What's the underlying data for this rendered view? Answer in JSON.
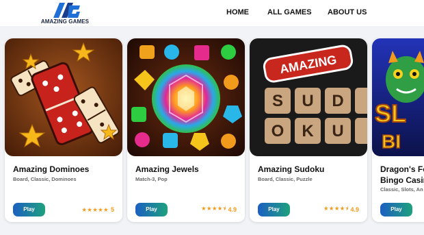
{
  "header": {
    "brand": "AMAZING GAMES",
    "nav": [
      {
        "label": "HOME"
      },
      {
        "label": "ALL GAMES"
      },
      {
        "label": "ABOUT US"
      }
    ]
  },
  "games": [
    {
      "title": "Amazing Dominoes",
      "tags": "Board, Classic, Dominoes",
      "play_label": "Play",
      "stars": "★★★★★",
      "rating": "5",
      "rating_value": 5
    },
    {
      "title": "Amazing Jewels",
      "tags": "Match-3, Pop",
      "play_label": "Play",
      "stars": "★★★★⯨",
      "rating": "4.9",
      "rating_value": 4.9
    },
    {
      "title": "Amazing Sudoku",
      "tags": "Board, Classic, Puzzle",
      "play_label": "Play",
      "stars": "★★★★⯨",
      "rating": "4.9",
      "rating_value": 4.9,
      "thumb_text": [
        "AMAZING",
        "S",
        "U",
        "D",
        "O",
        "K",
        "U"
      ]
    },
    {
      "title_line1": "Dragon's Fo",
      "title_line2": "Bingo Casin",
      "tags": "Classic, Slots, An",
      "play_label": "Play",
      "thumb_text": [
        "SL",
        "BI"
      ]
    }
  ],
  "colors": {
    "accent_button_start": "#1c5fc2",
    "accent_button_end": "#1ea17d",
    "star": "#f29a1b",
    "page_bg": "#f1f3f6"
  },
  "icons": [
    "ag-logo-icon",
    "star-icon"
  ]
}
